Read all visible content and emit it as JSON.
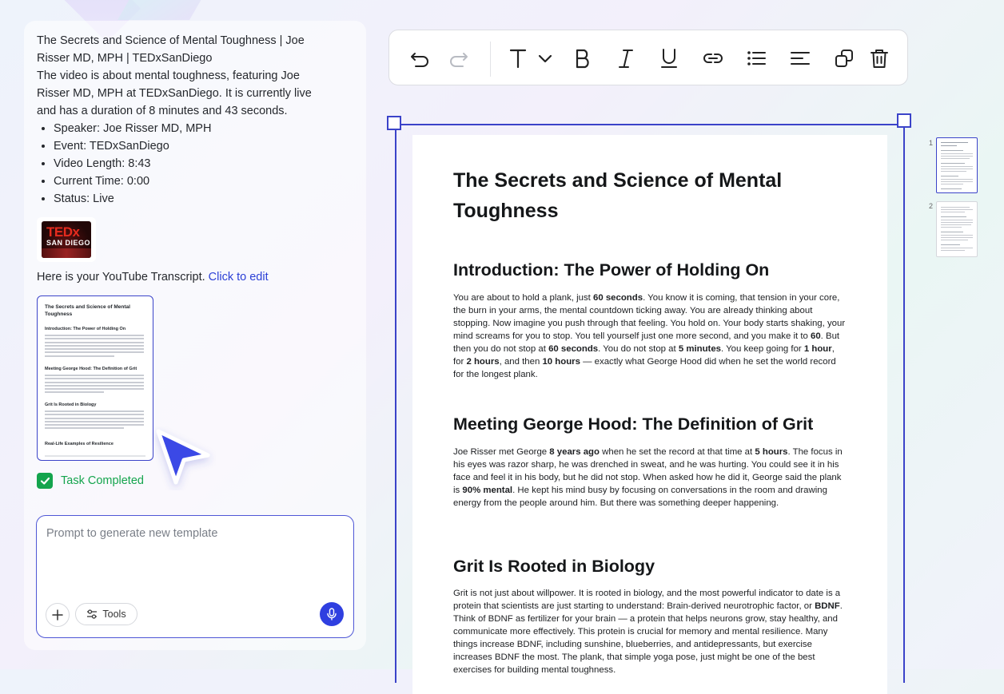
{
  "chat": {
    "video_title": "The Secrets and Science of Mental Toughness | Joe Risser MD, MPH | TEDxSanDiego",
    "summary": "The video is about mental toughness, featuring Joe Risser MD, MPH at TEDxSanDiego. It is currently live and has a duration of 8 minutes and 43 seconds.",
    "details": [
      "Speaker: Joe Risser MD, MPH",
      "Event: TEDxSanDiego",
      "Video Length: 8:43",
      "Current Time: 0:00",
      "Status: Live"
    ],
    "thumbnail": {
      "logo_text": "TEDx",
      "city_text": "SAN DIEGO"
    },
    "transcript_text": "Here is your YouTube Transcript.",
    "edit_link": "Click to edit",
    "mini_doc": {
      "title": "The Secrets and Science of Mental Toughness",
      "headings": [
        "Introduction: The Power of Holding On",
        "Meeting George Hood: The Definition of Grit",
        "Grit Is Rooted in Biology",
        "Real-Life Examples of Resilience"
      ]
    },
    "task_status": "Task Completed",
    "prompt": {
      "placeholder": "Prompt to generate new template",
      "value": "",
      "tools_label": "Tools"
    }
  },
  "toolbar": {
    "buttons": [
      "undo-icon",
      "redo-icon",
      "text-style-icon",
      "bold-icon",
      "italic-icon",
      "underline-icon",
      "link-icon",
      "bullet-list-icon",
      "align-left-icon",
      "duplicate-icon",
      "delete-icon"
    ]
  },
  "document": {
    "title": "The Secrets and Science of Mental Toughness",
    "sections": [
      {
        "heading": "Introduction: The Power of Holding On",
        "parts": [
          {
            "t": "You are about to hold a plank, just "
          },
          {
            "b": "60 seconds"
          },
          {
            "t": ". You know it is coming, that tension in your core, the burn in your arms, the mental countdown ticking away. You are already thinking about stopping. Now imagine you push through that feeling. You hold on. Your body starts shaking, your mind screams for you to stop. You tell yourself just one more second, and you make it to "
          },
          {
            "b": "60"
          },
          {
            "t": ". But then you do not stop at "
          },
          {
            "b": "60 seconds"
          },
          {
            "t": ". You do not stop at "
          },
          {
            "b": "5 minutes"
          },
          {
            "t": ". You keep going for "
          },
          {
            "b": "1 hour"
          },
          {
            "t": ", for "
          },
          {
            "b": "2 hours"
          },
          {
            "t": ", and then "
          },
          {
            "b": "10 hours"
          },
          {
            "t": " — exactly what George Hood did when he set the world record for the longest plank."
          }
        ]
      },
      {
        "heading": "Meeting George Hood: The Definition of Grit",
        "parts": [
          {
            "t": "Joe Risser met George "
          },
          {
            "b": "8 years ago"
          },
          {
            "t": " when he set the record at that time at "
          },
          {
            "b": "5 hours"
          },
          {
            "t": ". The focus in his eyes was razor sharp, he was drenched in sweat, and he was hurting. You could see it in his face and feel it in his body, but he did not stop. When asked how he did it, George said the plank is "
          },
          {
            "b": "90% mental"
          },
          {
            "t": ". He kept his mind busy by focusing on conversations in the room and drawing energy from the people around him. But there was something deeper happening."
          }
        ]
      },
      {
        "heading": "Grit Is Rooted in Biology",
        "parts": [
          {
            "t": "Grit is not just about willpower. It is rooted in biology, and the most powerful indicator to date is a protein that scientists are just starting to understand: Brain-derived neurotrophic factor, or "
          },
          {
            "b": "BDNF"
          },
          {
            "t": ". Think of BDNF as fertilizer for your brain — a protein that helps neurons grow, stay healthy, and communicate more effectively. This protein is crucial for memory and mental resilience. Many things increase BDNF, including sunshine, blueberries, and antidepressants, but exercise increases BDNF the most. The plank, that simple yoga pose, just might be one of the best exercises for building mental toughness."
          }
        ]
      }
    ]
  },
  "pages": [
    {
      "number": "1",
      "active": true
    },
    {
      "number": "2",
      "active": false
    }
  ]
}
